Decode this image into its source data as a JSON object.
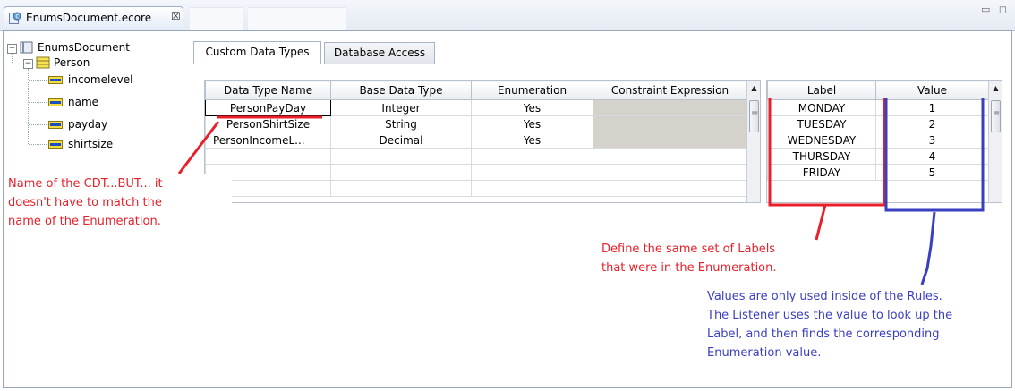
{
  "editor": {
    "tab_title": "EnumsDocument.ecore",
    "close_glyph": "☒",
    "window_controls": "▭ ◻"
  },
  "tree": {
    "root": {
      "label": "EnumsDocument",
      "icon": "book-icon",
      "expander": "−"
    },
    "class": {
      "label": "Person",
      "icon": "class-icon",
      "expander": "−"
    },
    "attributes": [
      {
        "label": "incomelevel",
        "icon": "attribute-icon"
      },
      {
        "label": "name",
        "icon": "attribute-icon"
      },
      {
        "label": "payday",
        "icon": "attribute-icon"
      },
      {
        "label": "shirtsize",
        "icon": "attribute-icon"
      }
    ]
  },
  "tabs": [
    {
      "label": "Custom Data Types",
      "selected": true
    },
    {
      "label": "Database Access",
      "selected": false
    }
  ],
  "cdt_table": {
    "headers": [
      "Data Type Name",
      "Base Data Type",
      "Enumeration",
      "Constraint Expression"
    ],
    "rows": [
      {
        "name": "PersonPayDay",
        "base": "Integer",
        "enumeration": "Yes",
        "constraint": ""
      },
      {
        "name": "PersonShirtSize",
        "base": "String",
        "enumeration": "Yes",
        "constraint": ""
      },
      {
        "name": "PersonIncomeL...",
        "base": "Decimal",
        "enumeration": "Yes",
        "constraint": ""
      }
    ],
    "selected_cell": "PersonPayDay"
  },
  "enum_table": {
    "headers": [
      "Label",
      "Value"
    ],
    "rows": [
      {
        "label": "MONDAY",
        "value": "1"
      },
      {
        "label": "TUESDAY",
        "value": "2"
      },
      {
        "label": "WEDNESDAY",
        "value": "3"
      },
      {
        "label": "THURSDAY",
        "value": "4"
      },
      {
        "label": "FRIDAY",
        "value": "5"
      }
    ]
  },
  "scrollbar": {
    "up_arrow": "▲",
    "grip": "≡"
  },
  "annotations": {
    "cdt_name": [
      "Name of the CDT...BUT... it",
      "doesn't have to match the",
      "name of the Enumeration."
    ],
    "labels": [
      "Define the same set of Labels",
      "that were in the Enumeration."
    ],
    "values": [
      "Values are only used inside of the Rules.",
      "The Listener uses the value to look up the",
      "Label, and then finds the corresponding",
      "Enumeration value."
    ]
  },
  "colors": {
    "annotation_red": "#e8202a",
    "annotation_blue": "#3a3fbf",
    "grey_cell": "#d5d1cb"
  }
}
